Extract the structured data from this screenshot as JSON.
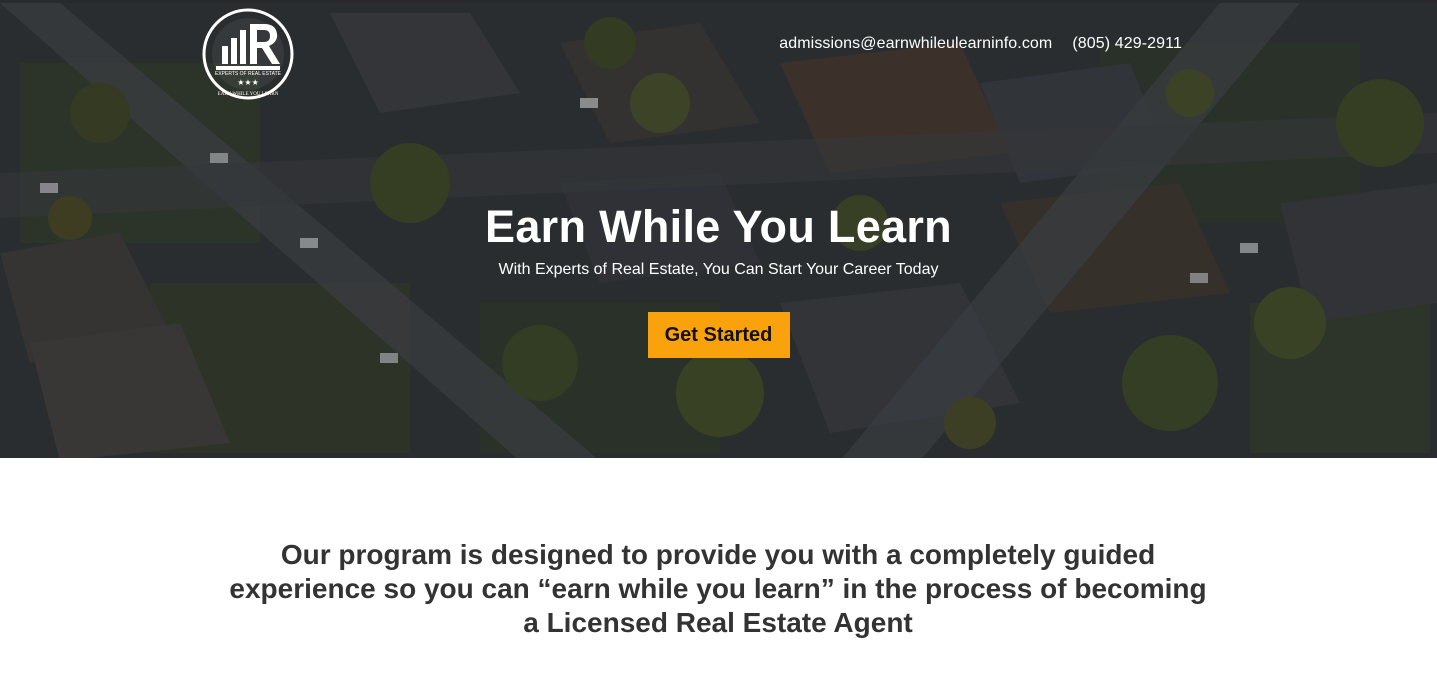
{
  "header": {
    "logo": {
      "icon": "real-estate-logo-icon",
      "text_top": "EXPERTS OF REAL ESTATE",
      "text_bottom": "EARN WHILE YOU LEARN"
    },
    "email": "admissions@earnwhileulearninfo.com",
    "phone": "(805) 429-2911"
  },
  "hero": {
    "title": "Earn While You Learn",
    "subtitle": "With Experts of Real Estate, You Can Start Your Career Today",
    "cta_label": "Get Started",
    "background": "aerial-neighborhood-photo"
  },
  "program": {
    "text": "Our program is designed to provide you with a completely guided experience so you can “earn while you learn” in the process of becoming a Licensed Real Estate Agent"
  },
  "colors": {
    "accent": "#f9a20b",
    "text_dark": "#333333",
    "overlay": "#14161a"
  }
}
